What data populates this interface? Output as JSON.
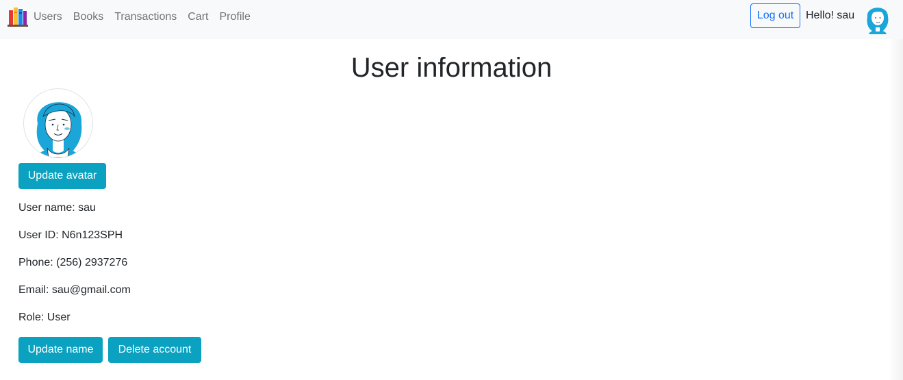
{
  "navbar": {
    "brand_icon": "books-logo-icon",
    "links": [
      "Users",
      "Books",
      "Transactions",
      "Cart",
      "Profile"
    ],
    "logout_label": "Log out",
    "greeting": "Hello! sau",
    "avatar_icon": "user-avatar-icon"
  },
  "main": {
    "title": "User information",
    "avatar_icon": "user-avatar-icon",
    "update_avatar_label": "Update avatar",
    "fields": [
      "User name: sau",
      "User ID: N6n123SPH",
      "Phone: (256) 2937276",
      "Email: sau@gmail.com",
      "Role: User"
    ],
    "update_name_label": "Update name",
    "delete_account_label": "Delete account"
  },
  "colors": {
    "navbar_bg": "#f8f9fa",
    "primary": "#0d6efd",
    "info_button": "#0aa2c0",
    "avatar_blue": "#1aa6d9"
  }
}
